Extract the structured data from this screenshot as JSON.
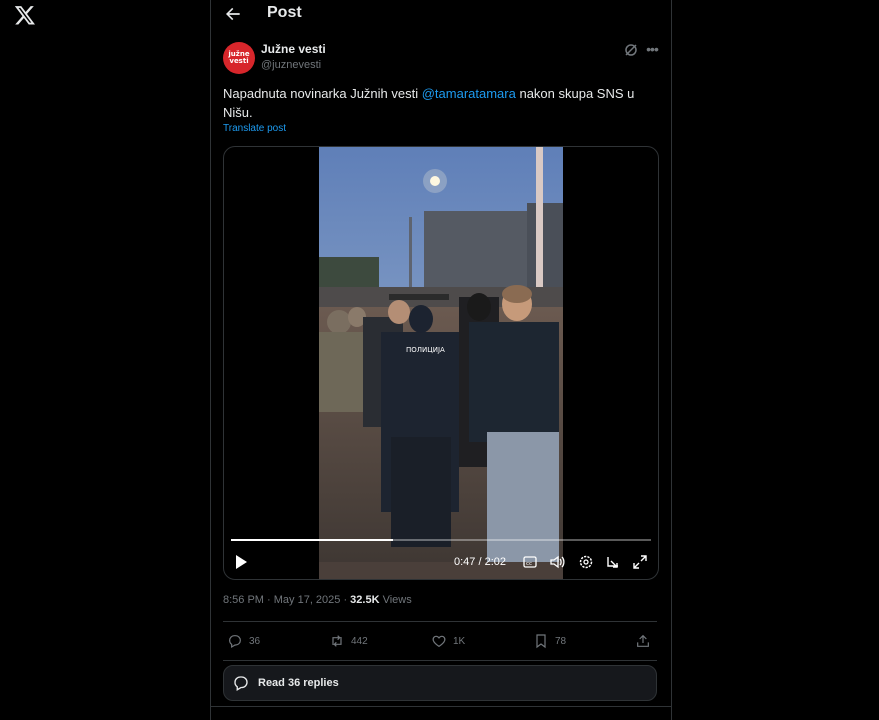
{
  "header": {
    "title": "Post"
  },
  "author": {
    "name": "Južne vesti",
    "handle": "@juznevesti",
    "avatar_text_1": "južne",
    "avatar_text_2": "vesti"
  },
  "post": {
    "text_before": "Napadnuta novinarka Južnih vesti ",
    "mention": "@tamaratamara",
    "text_after": "  nakon skupa SNS u Nišu.",
    "translate": "Translate post"
  },
  "video": {
    "current_time": "0:47",
    "duration": "2:02",
    "timecode": "0:47 / 2:02",
    "progress": 0.385,
    "vest_text": "ПОЛИЦИЈА"
  },
  "meta": {
    "time": "8:56 PM · May 17, 2025 · ",
    "views_count": "32.5K",
    "views_label": " Views"
  },
  "actions": {
    "replies": "36",
    "reposts": "442",
    "likes": "1K",
    "bookmarks": "78"
  },
  "read_replies": "Read 36 replies",
  "colors": {
    "accent": "#1d9bf0",
    "muted": "#71767b",
    "text": "#e7e9ea",
    "border": "#2f3336"
  }
}
